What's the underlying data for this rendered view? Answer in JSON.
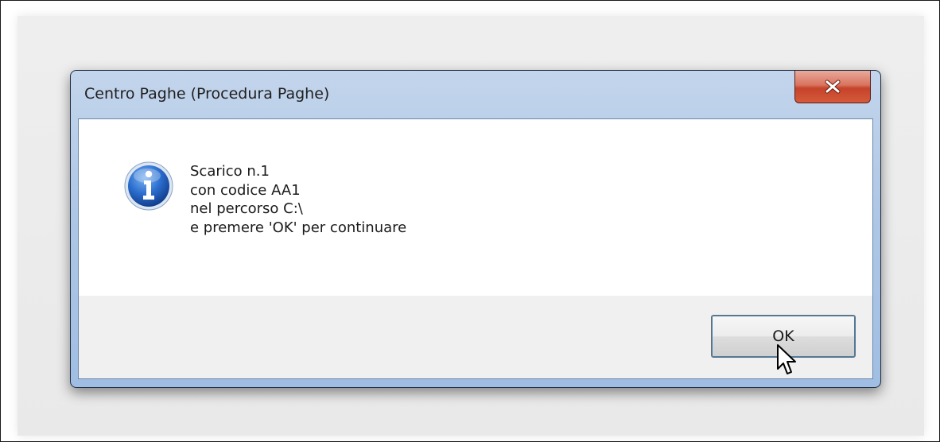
{
  "window": {
    "title": "Centro Paghe (Procedura Paghe)",
    "close_icon": "close-icon"
  },
  "dialog": {
    "icon": "info-icon",
    "message_lines": [
      "Scarico n.1",
      "con codice AA1",
      "nel percorso C:\\",
      "e premere 'OK' per continuare"
    ],
    "ok_label": "OK"
  },
  "colors": {
    "close_button": "#c5432a",
    "info_icon": "#1d5fb4",
    "focus_ring": "#3c7fb1"
  }
}
